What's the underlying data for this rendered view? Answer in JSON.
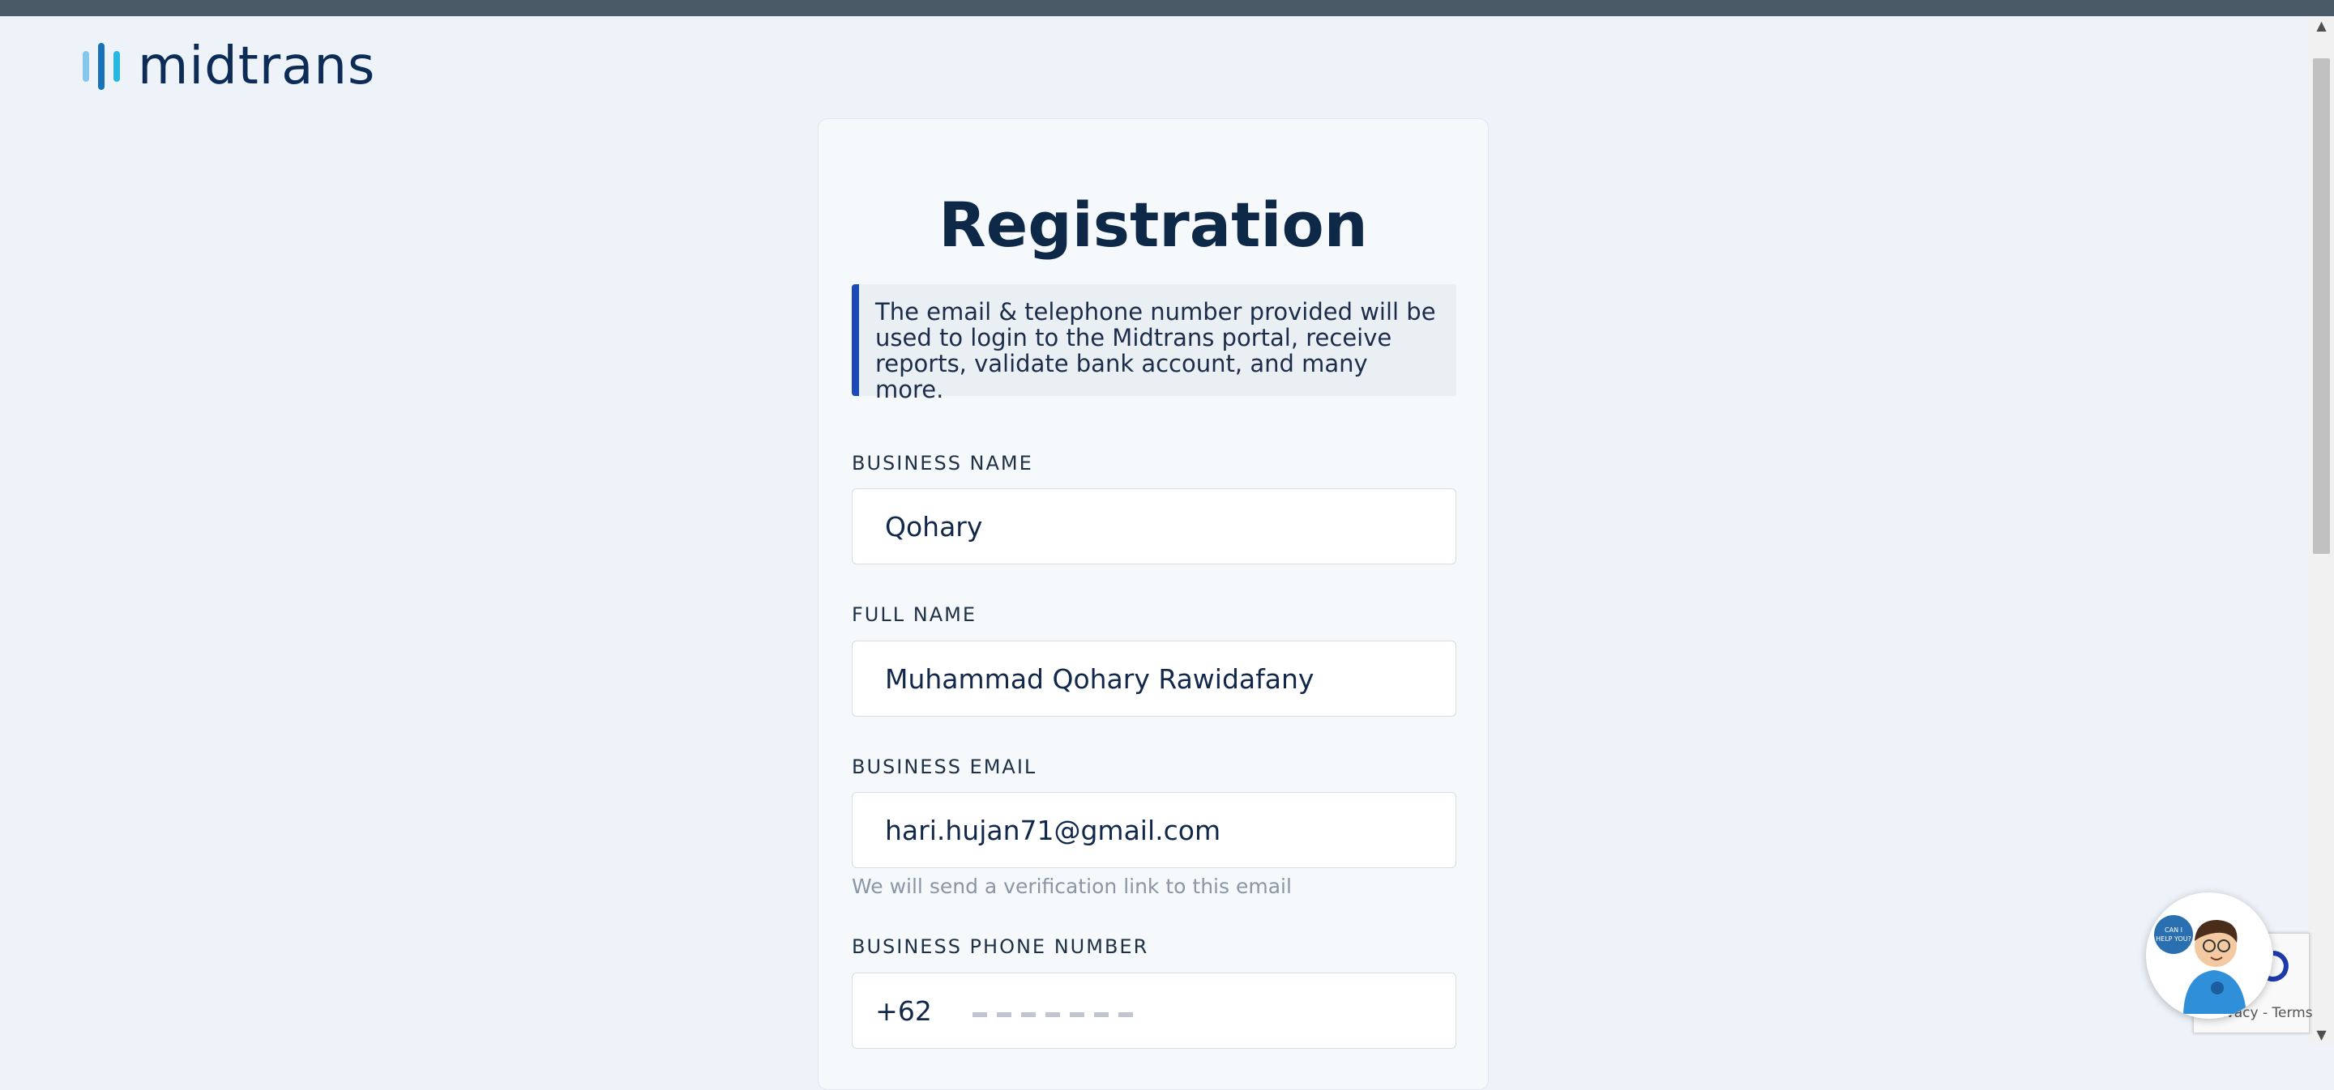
{
  "header": {
    "logo_text": "midtrans"
  },
  "form": {
    "title": "Registration",
    "notice": "The email & telephone number provided will be used to login to the Midtrans portal, receive reports, validate bank account, and many more.",
    "business_name": {
      "label": "BUSINESS NAME",
      "value": "Qohary"
    },
    "full_name": {
      "label": "FULL NAME",
      "value": "Muhammad Qohary Rawidafany"
    },
    "business_email": {
      "label": "BUSINESS EMAIL",
      "value": "hari.hujan71@gmail.com",
      "hint": "We will send a verification link to this email"
    },
    "phone": {
      "label": "BUSINESS PHONE NUMBER",
      "prefix": "+62"
    }
  },
  "widgets": {
    "chat_bubble_text": "CAN I HELP YOU?",
    "recaptcha_terms": "Privacy - Terms"
  },
  "colors": {
    "page_bg": "#edf3f9",
    "accent": "#1a4ab5",
    "brand_navy": "#0c2c57"
  },
  "icons": {
    "logo": "midtrans-logo-icon",
    "chat": "assistant-avatar-icon",
    "recaptcha": "recaptcha-icon"
  }
}
